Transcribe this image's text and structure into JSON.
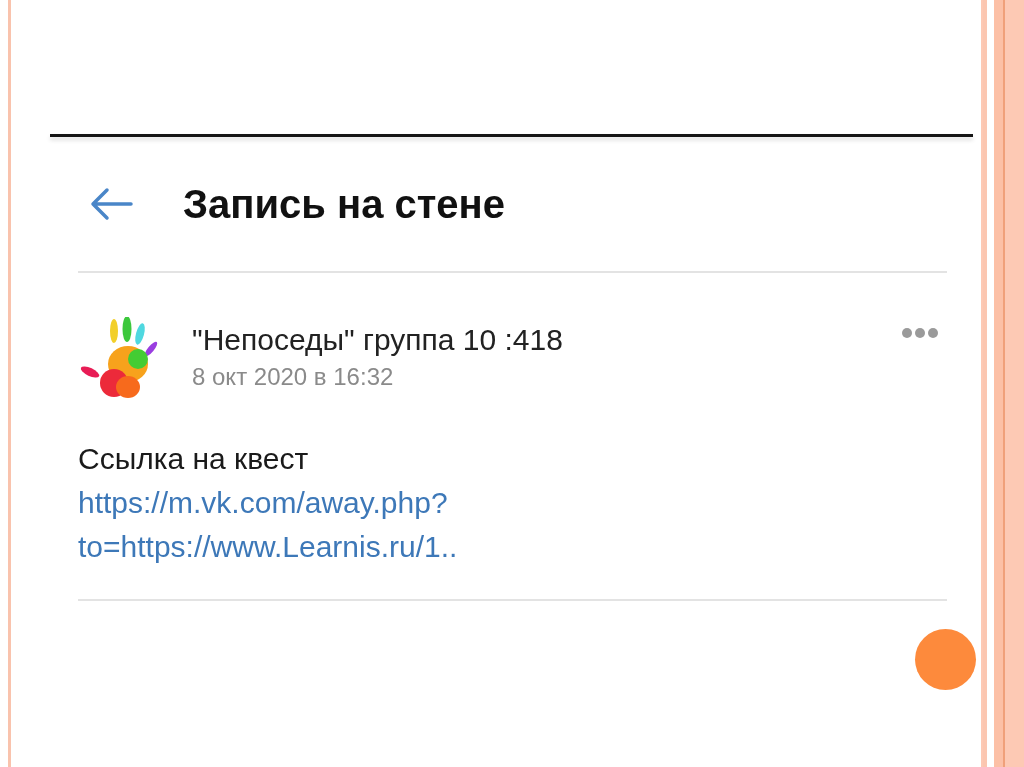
{
  "header": {
    "title": "Запись на стене"
  },
  "post": {
    "author": "\"Непоседы\" группа 10 :418",
    "date": "8 окт 2020 в 16:32",
    "text": "Ссылка на квест",
    "link_lines": [
      "https://m.vk.com/away.php?",
      "to=https://www.Learnis.ru/1.."
    ]
  }
}
